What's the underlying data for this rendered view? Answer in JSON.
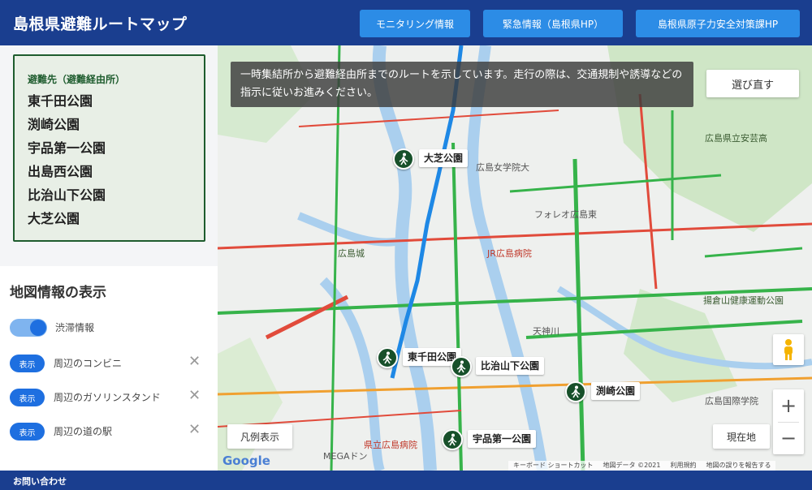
{
  "header": {
    "title": "島根県避難ルートマップ",
    "buttons": [
      "モニタリング情報",
      "緊急情報（島根県HP）",
      "島根県原子力安全対策課HP"
    ]
  },
  "sidebar": {
    "destination_heading": "避難先（避難経由所）",
    "destinations": [
      "東千田公園",
      "渕崎公園",
      "宇品第一公園",
      "出島西公園",
      "比治山下公園",
      "大芝公園"
    ],
    "map_info_title": "地図情報の表示",
    "traffic_toggle": {
      "label": "渋滞情報",
      "on": true
    },
    "layers": [
      {
        "badge": "表示",
        "label": "周辺のコンビニ"
      },
      {
        "badge": "表示",
        "label": "周辺のガソリンスタンド"
      },
      {
        "badge": "表示",
        "label": "周辺の道の駅"
      }
    ]
  },
  "map": {
    "notice": "一時集結所から避難経由所までのルートを示しています。走行の際は、交通規制や誘導などの指示に従いお進みください。",
    "reselect_button": "選び直す",
    "legend_button": "凡例表示",
    "current_location_button": "現在地",
    "zoom_in": "+",
    "zoom_out": "−",
    "google_logo": "Google",
    "attribution": [
      "キーボード ショートカット",
      "地図データ ©2021",
      "利用規約",
      "地図の誤りを報告する"
    ],
    "markers": [
      "大芝公園",
      "東千田公園",
      "比治山下公園",
      "渕崎公園",
      "宇品第一公園"
    ],
    "place_labels": [
      "広島県立安芸高",
      "広島女学院大",
      "フォレオ広島東",
      "JR広島病院",
      "広島城",
      "広島国際学院",
      "県立広島病院",
      "MEGAドン",
      "天神川",
      "揚倉山健康運動公園"
    ],
    "route_color": "#1e88e5",
    "marker_color": "#17502a"
  },
  "footer": {
    "contact": "お問い合わせ"
  }
}
